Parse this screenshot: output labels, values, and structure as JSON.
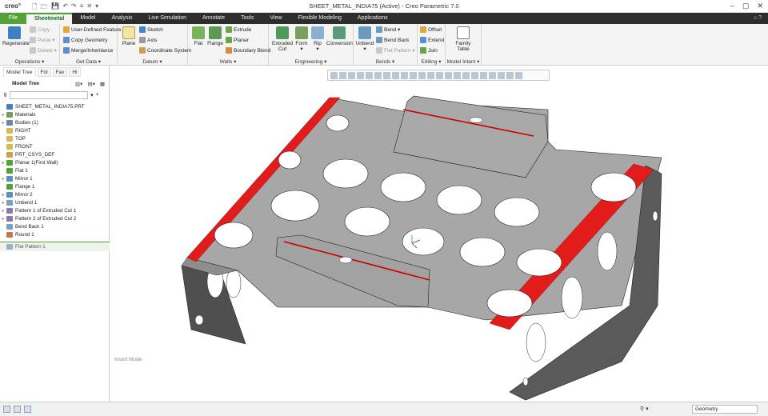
{
  "titlebar": {
    "logo": "creo°",
    "title": "SHEET_METAL_INDIA75 (Active) - Creo Parametric 7.0",
    "quick_access": [
      "🗋",
      "🗁",
      "💾",
      "↶",
      "↷",
      "≡",
      "✕",
      "▾"
    ]
  },
  "tabs": [
    "File",
    "Sheetmetal",
    "Model",
    "Analysis",
    "Live Simulation",
    "Annotate",
    "Tools",
    "View",
    "Flexible Modeling",
    "Applications"
  ],
  "ribbon": {
    "operations": {
      "label": "Operations ▾",
      "regenerate": "Regenerate",
      "copy": "Copy",
      "paste": "Paste ▾",
      "delete": "Delete ▾"
    },
    "getdata": {
      "label": "Get Data ▾",
      "udf": "User-Defined Feature",
      "copygeom": "Copy Geometry",
      "merge": "Merge/Inheritance"
    },
    "datum": {
      "label": "Datum ▾",
      "plane": "Plane",
      "sketch": "Sketch",
      "axis": "Axis",
      "csys": "Coordinate System"
    },
    "walls": {
      "label": "Walls ▾",
      "flat": "Flat",
      "flange": "Flange",
      "extrude": "Extrude",
      "planar": "Planar",
      "boundary": "Boundary Blend"
    },
    "engineering": {
      "label": "Engineering ▾",
      "extcut1": "Extruded",
      "extcut2": "Cut",
      "form": "Form",
      "rip": "Rip",
      "conversion": "Conversion"
    },
    "bends": {
      "label": "Bends ▾",
      "unbend": "Unbend",
      "bend": "Bend ▾",
      "bendback": "Bend Back",
      "flatpattern": "Flat Pattern ▾"
    },
    "editing": {
      "label": "Editing ▾",
      "offset": "Offset",
      "extend": "Extend",
      "join": "Join"
    },
    "intent": {
      "label": "Model Intent ▾",
      "family1": "Family",
      "family2": "Table"
    }
  },
  "panel": {
    "tabs": [
      "Model Tree",
      "Fol",
      "Fav",
      "Hi"
    ],
    "header": "Model Tree",
    "tree": [
      {
        "label": "SHEET_METAL_INDIA75.PRT",
        "exp": "",
        "color": "#4a7fbf"
      },
      {
        "label": "Materials",
        "exp": "▸",
        "color": "#7a9a5a"
      },
      {
        "label": "Bodies (1)",
        "exp": "▸",
        "color": "#6688aa"
      },
      {
        "label": "RIGHT",
        "exp": "",
        "color": "#d8b85a"
      },
      {
        "label": "TOP",
        "exp": "",
        "color": "#d8b85a"
      },
      {
        "label": "FRONT",
        "exp": "",
        "color": "#d8b85a"
      },
      {
        "label": "PRT_CSYS_DEF",
        "exp": "",
        "color": "#c9a24a"
      },
      {
        "label": "Planar 1(First Wall)",
        "exp": "▸",
        "color": "#53a137"
      },
      {
        "label": "Flat 1",
        "exp": "",
        "color": "#53a137"
      },
      {
        "label": "Mirror 1",
        "exp": "▸",
        "color": "#5a8fc0"
      },
      {
        "label": "Flange 1",
        "exp": "",
        "color": "#53a137"
      },
      {
        "label": "Mirror 2",
        "exp": "▸",
        "color": "#5a8fc0"
      },
      {
        "label": "Unbend 1",
        "exp": "▸",
        "color": "#7aa0c0"
      },
      {
        "label": "Pattern 1 of Extruded Cut 1",
        "exp": "▸",
        "color": "#8a7ab0"
      },
      {
        "label": "Pattern 2 of Extruded Cut 2",
        "exp": "▸",
        "color": "#8a7ab0"
      },
      {
        "label": "Bend Back 1",
        "exp": "",
        "color": "#7aa0c0"
      },
      {
        "label": "Round 1",
        "exp": "",
        "color": "#c07a4a"
      }
    ],
    "last_item": "Flat Pattern 1"
  },
  "viewport": {
    "mode": "Insert Mode"
  },
  "status": {
    "filter": "Geometry",
    "icon": "⚲ ▾"
  },
  "colors": {
    "accent": "#53a137",
    "dark_tab": "#2d2d2d",
    "bend_red": "#e21b1b",
    "sheet_gray": "#a7a7a7"
  }
}
